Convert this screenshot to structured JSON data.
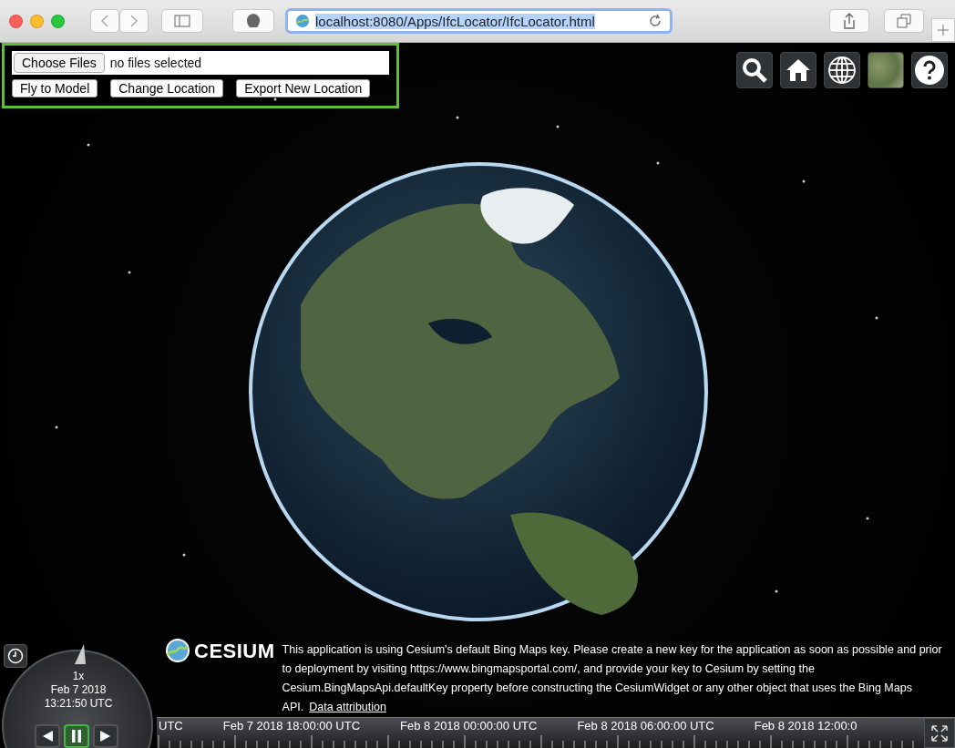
{
  "browser": {
    "url": "localhost:8080/Apps/IfcLocator/IfcLocator.html"
  },
  "file_panel": {
    "choose_button": "Choose Files",
    "file_status": "no files selected",
    "buttons": [
      "Fly to Model",
      "Change Location",
      "Export New Location"
    ]
  },
  "toolbar": [
    {
      "kind": "search"
    },
    {
      "kind": "home"
    },
    {
      "kind": "globe"
    },
    {
      "kind": "imagery"
    },
    {
      "kind": "help"
    }
  ],
  "credit": {
    "logo": "CESIUM",
    "message": "This application is using Cesium's default Bing Maps key. Please create a new key for the application as soon as possible and prior to deployment by visiting https://www.bingmapsportal.com/, and provide your key to Cesium by setting the Cesium.BingMapsApi.defaultKey property before constructing the CesiumWidget or any other object that uses the Bing Maps API.",
    "link": "Data attribution"
  },
  "animation": {
    "speed": "1x",
    "date": "Feb 7 2018",
    "time": "13:21:50 UTC",
    "controls": [
      {
        "kind": "reverse",
        "selected": false
      },
      {
        "kind": "pause",
        "selected": true
      },
      {
        "kind": "play",
        "selected": false
      }
    ]
  },
  "timeline": {
    "labels": [
      "UTC",
      "Feb 7 2018 18:00:00 UTC",
      "Feb 8 2018 00:00:00 UTC",
      "Feb 8 2018 06:00:00 UTC",
      "Feb 8 2018 12:00:0"
    ]
  }
}
